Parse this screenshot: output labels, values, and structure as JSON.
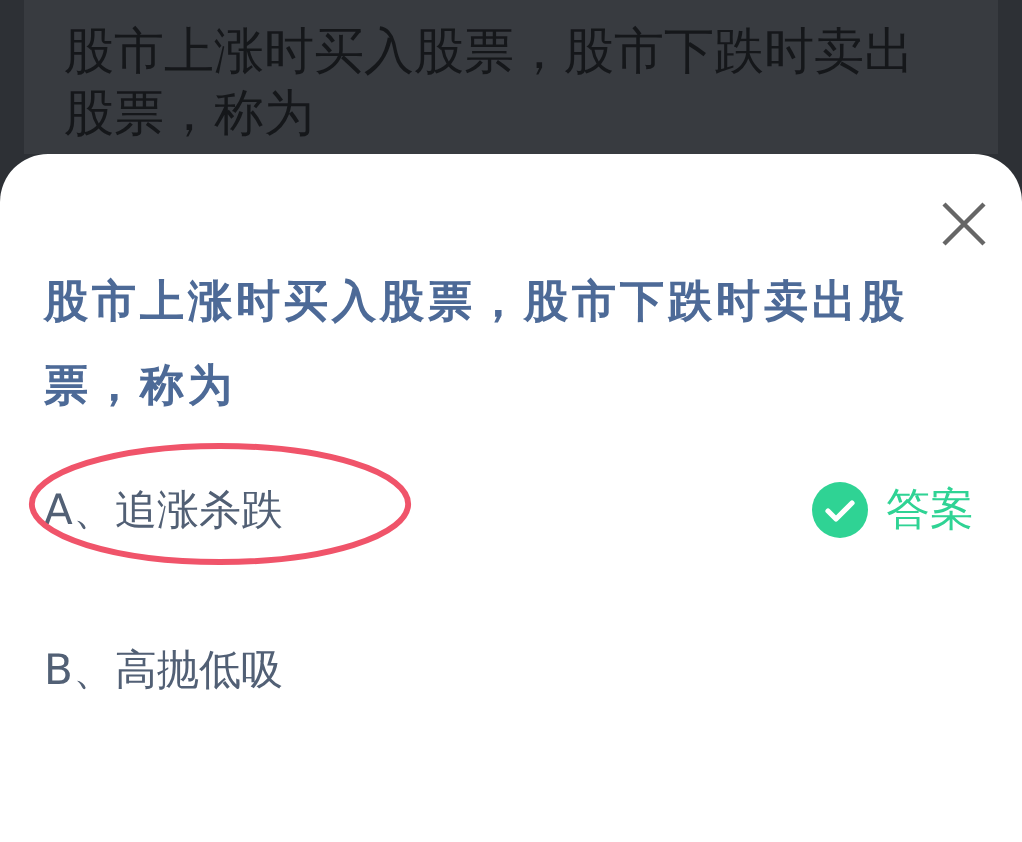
{
  "background_question": "股市上涨时买入股票，股市下跌时卖出股票，称为",
  "sheet": {
    "question": "股市上涨时买入股票，股市下跌时卖出股票，称为",
    "options": [
      {
        "label": "A、追涨杀跌",
        "correct": true,
        "circled": true,
        "answer_label": "答案"
      },
      {
        "label": "B、高抛低吸",
        "correct": false,
        "circled": false
      }
    ]
  }
}
